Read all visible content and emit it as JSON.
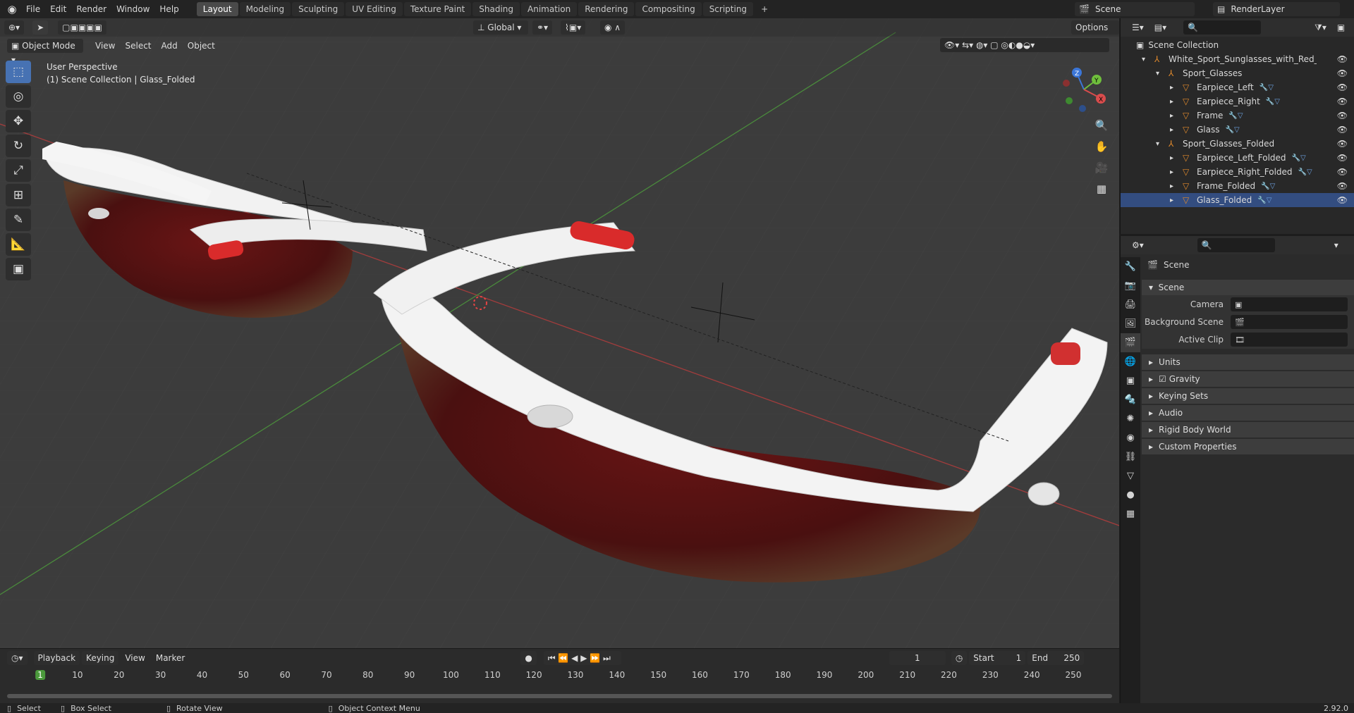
{
  "app": {
    "menu": [
      "File",
      "Edit",
      "Render",
      "Window",
      "Help"
    ],
    "workspaces": [
      "Layout",
      "Modeling",
      "Sculpting",
      "UV Editing",
      "Texture Paint",
      "Shading",
      "Animation",
      "Rendering",
      "Compositing",
      "Scripting"
    ],
    "active_workspace": "Layout",
    "add_workspace": "+",
    "scene_name": "Scene",
    "view_layer": "RenderLayer"
  },
  "viewport": {
    "mode": "Object Mode",
    "menu": [
      "View",
      "Select",
      "Add",
      "Object"
    ],
    "transform_orientation": "Global",
    "options_label": "Options",
    "info_line1": "User Perspective",
    "info_line2": "(1) Scene Collection | Glass_Folded",
    "gizmo_axes": {
      "x": "X",
      "y": "Y",
      "z": "Z"
    }
  },
  "timeline": {
    "menu": [
      "Playback",
      "Keying",
      "View",
      "Marker"
    ],
    "current_frame": "1",
    "start_label": "Start",
    "start": "1",
    "end_label": "End",
    "end": "250",
    "ticks": [
      "1",
      "10",
      "20",
      "30",
      "40",
      "50",
      "60",
      "70",
      "80",
      "90",
      "100",
      "110",
      "120",
      "130",
      "140",
      "150",
      "160",
      "170",
      "180",
      "190",
      "200",
      "210",
      "220",
      "230",
      "240",
      "250"
    ]
  },
  "outliner": {
    "root": "Scene Collection",
    "rows": [
      {
        "label": "White_Sport_Sunglasses_with_Red_Lenses_S",
        "indent": 1,
        "type": "empty"
      },
      {
        "label": "Sport_Glasses",
        "indent": 2,
        "type": "empty"
      },
      {
        "label": "Earpiece_Left",
        "indent": 3,
        "type": "mesh"
      },
      {
        "label": "Earpiece_Right",
        "indent": 3,
        "type": "mesh"
      },
      {
        "label": "Frame",
        "indent": 3,
        "type": "mesh"
      },
      {
        "label": "Glass",
        "indent": 3,
        "type": "mesh"
      },
      {
        "label": "Sport_Glasses_Folded",
        "indent": 2,
        "type": "empty"
      },
      {
        "label": "Earpiece_Left_Folded",
        "indent": 3,
        "type": "mesh"
      },
      {
        "label": "Earpiece_Right_Folded",
        "indent": 3,
        "type": "mesh"
      },
      {
        "label": "Frame_Folded",
        "indent": 3,
        "type": "mesh"
      },
      {
        "label": "Glass_Folded",
        "indent": 3,
        "type": "mesh",
        "selected": true
      }
    ]
  },
  "properties": {
    "context": "Scene",
    "section_scene": "Scene",
    "camera_label": "Camera",
    "background_scene_label": "Background Scene",
    "active_clip_label": "Active Clip",
    "sections": [
      "Units",
      "Gravity",
      "Keying Sets",
      "Audio",
      "Rigid Body World",
      "Custom Properties"
    ]
  },
  "statusbar": {
    "select": "Select",
    "box_select": "Box Select",
    "rotate_view": "Rotate View",
    "context_menu": "Object Context Menu",
    "version": "2.92.0"
  },
  "colors": {
    "accent": "#4772b3",
    "axis_x": "#d94c4c",
    "axis_y": "#6fbf3c",
    "axis_z": "#3b76d8",
    "lens_red": "#7a1c1c",
    "frame_white": "#f1f1f1"
  }
}
